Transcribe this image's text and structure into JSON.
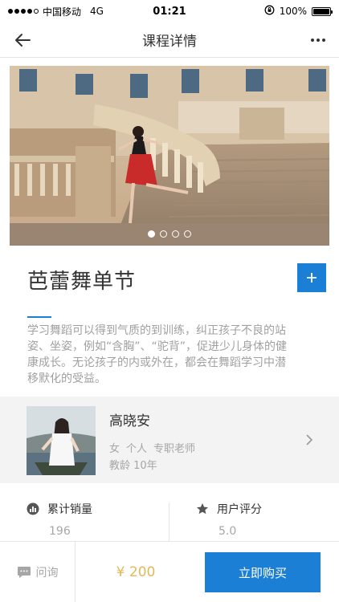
{
  "status_bar": {
    "carrier": "中国移动",
    "network": "4G",
    "time": "01:21",
    "battery": "100%",
    "battery_level": 1.0
  },
  "nav": {
    "title": "课程详情",
    "back_icon": "arrow-left-icon",
    "more_icon": "more-horizontal-icon"
  },
  "carousel": {
    "slide_count": 4,
    "active_index": 0
  },
  "course": {
    "title": "芭蕾舞单节",
    "add_icon": "plus-icon",
    "description": "学习舞蹈可以得到气质的到训练，纠正孩子不良的站姿、坐姿，例如“含胸”、“驼背”，促进少儿身体的健康成长。无论孩子的内或外在，都会在舞蹈学习中潜移默化的受益。"
  },
  "teacher": {
    "name": "高晓安",
    "gender": "女",
    "type": "个人",
    "role": "专职老师",
    "experience": "教龄 10年"
  },
  "stats": {
    "sales_label": "累计销量",
    "sales_value": "196",
    "rating_label": "用户评分",
    "rating_value": "5.0"
  },
  "bottom_bar": {
    "ask_label": "问询",
    "price": "¥ 200",
    "buy_label": "立即购买"
  },
  "colors": {
    "accent": "#1b7fd6",
    "price": "#e2b95a",
    "muted_text": "#a6a6a6"
  }
}
